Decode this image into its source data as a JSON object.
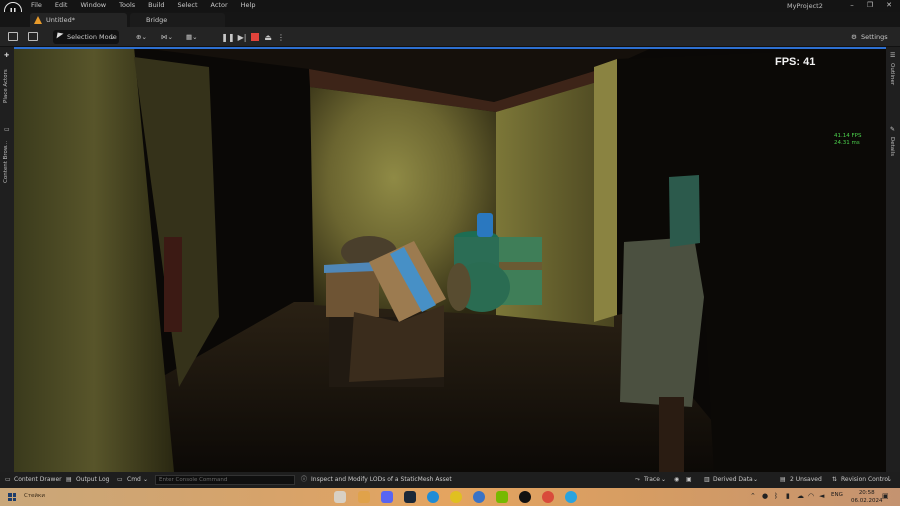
{
  "app": {
    "logo": "U",
    "project": "MyProject2",
    "window_controls": [
      "–",
      "❐",
      "✕"
    ]
  },
  "menu": [
    "File",
    "Edit",
    "Window",
    "Tools",
    "Build",
    "Select",
    "Actor",
    "Help"
  ],
  "tabs": [
    {
      "label": "Untitled*",
      "active": true
    },
    {
      "label": "Bridge",
      "active": false
    }
  ],
  "toolbar": {
    "mode": "Selection Mode",
    "settings": "Settings",
    "play_controls": [
      "pause",
      "step",
      "stop",
      "eject"
    ]
  },
  "side_panels": {
    "left": [
      "Place Actors",
      "Content Brow..."
    ],
    "right": [
      "Outliner",
      "Details"
    ]
  },
  "viewport": {
    "fps_big": "FPS: 41",
    "fps_small": [
      "41.14 FPS",
      "24.31 ms"
    ]
  },
  "statusbar": {
    "content_drawer": "Content Drawer",
    "output_log": "Output Log",
    "cmd": "Cmd",
    "console_placeholder": "Enter Console Command",
    "hint": "Inspect and Modify LODs of a StaticMesh Asset",
    "trace": "Trace",
    "derived_data": "Derived Data",
    "unsaved": "2 Unsaved",
    "revision_control": "Revision Control"
  },
  "taskbar": {
    "search": "Стейки",
    "lang": "ENG",
    "time": "20:58",
    "date": "06.02.2024"
  },
  "colors": {
    "accent": "#2d6fd0",
    "stop": "#e0433b",
    "fps_small": "#4cd14c"
  }
}
